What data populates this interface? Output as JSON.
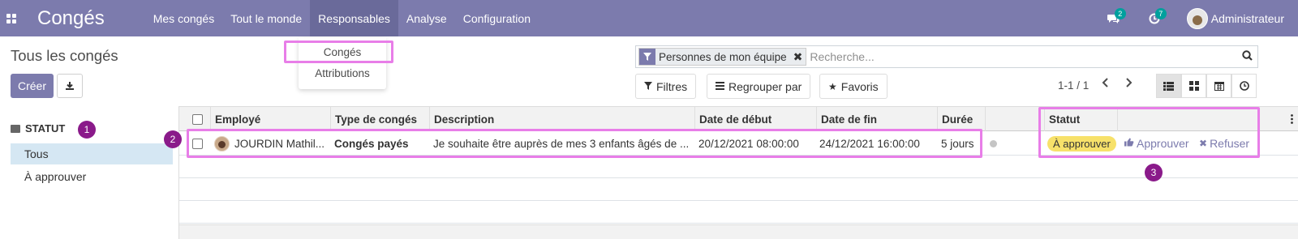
{
  "navbar": {
    "brand": "Congés",
    "menu": [
      "Mes congés",
      "Tout le monde",
      "Responsables",
      "Analyse",
      "Configuration"
    ],
    "active_menu": "Responsables",
    "messages_count": "2",
    "activities_count": "7",
    "user_name": "Administrateur",
    "bg_color": "#7c7bad"
  },
  "dropdown": {
    "items": [
      "Congés",
      "Attributions"
    ]
  },
  "control_panel": {
    "title": "Tous les congés",
    "create_label": "Créer",
    "search": {
      "facet": "Personnes de mon équipe",
      "placeholder": "Recherche..."
    },
    "filters_label": "Filtres",
    "groupby_label": "Regrouper par",
    "favorites_label": "Favoris",
    "pager": "1-1 / 1"
  },
  "sidebar": {
    "header": "STATUT",
    "items": [
      "Tous",
      "À approuver"
    ],
    "active_index": 0
  },
  "table": {
    "headers": [
      "Employé",
      "Type de congés",
      "Description",
      "Date de début",
      "Date de fin",
      "Durée",
      "Statut"
    ],
    "rows": [
      {
        "employee": "JOURDIN Mathil...",
        "leave_type": "Congés payés",
        "description": "Je souhaite être auprès de mes 3 enfants âgés de ...",
        "date_from": "20/12/2021 08:00:00",
        "date_to": "24/12/2021 16:00:00",
        "duration": "5 jours",
        "status": "À approuver",
        "approve_label": "Approuver",
        "refuse_label": "Refuser"
      }
    ]
  },
  "annotations": [
    "1",
    "2",
    "3"
  ],
  "highlight_color": "#e87ee8"
}
